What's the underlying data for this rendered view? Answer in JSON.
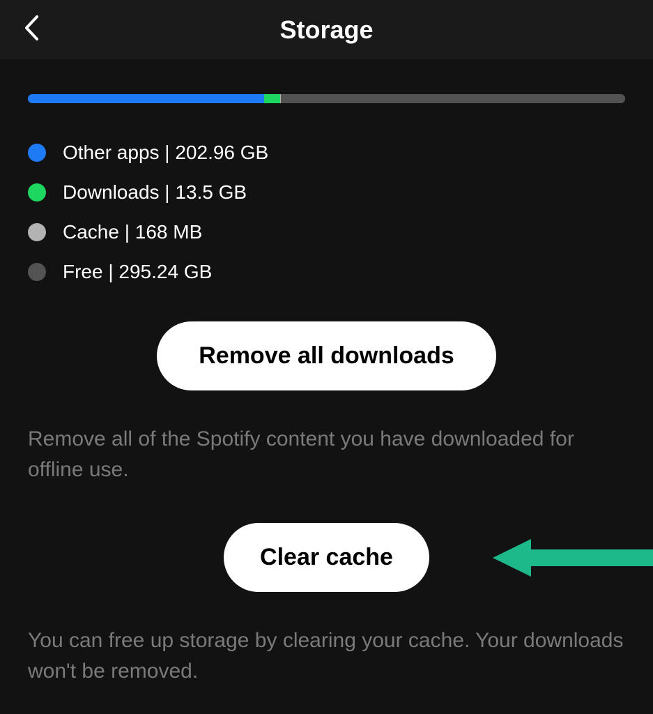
{
  "header": {
    "title": "Storage"
  },
  "bar": {
    "other_pct": 39.6,
    "downloads_pct": 2.6,
    "cache_pct": 0.2,
    "free_pct": 57.6
  },
  "legend": {
    "other": "Other apps | 202.96 GB",
    "downloads": "Downloads | 13.5 GB",
    "cache": "Cache | 168 MB",
    "free": "Free | 295.24 GB"
  },
  "buttons": {
    "remove_downloads": "Remove all downloads",
    "clear_cache": "Clear cache"
  },
  "descriptions": {
    "remove_downloads": "Remove all of the Spotify content you have downloaded for offline use.",
    "clear_cache": "You can free up storage by clearing your cache. Your downloads won't be removed."
  },
  "colors": {
    "other": "#1f7af6",
    "downloads": "#1ed760",
    "cache": "#b3b3b3",
    "free": "#535353",
    "annotation_arrow": "#1db98b"
  }
}
